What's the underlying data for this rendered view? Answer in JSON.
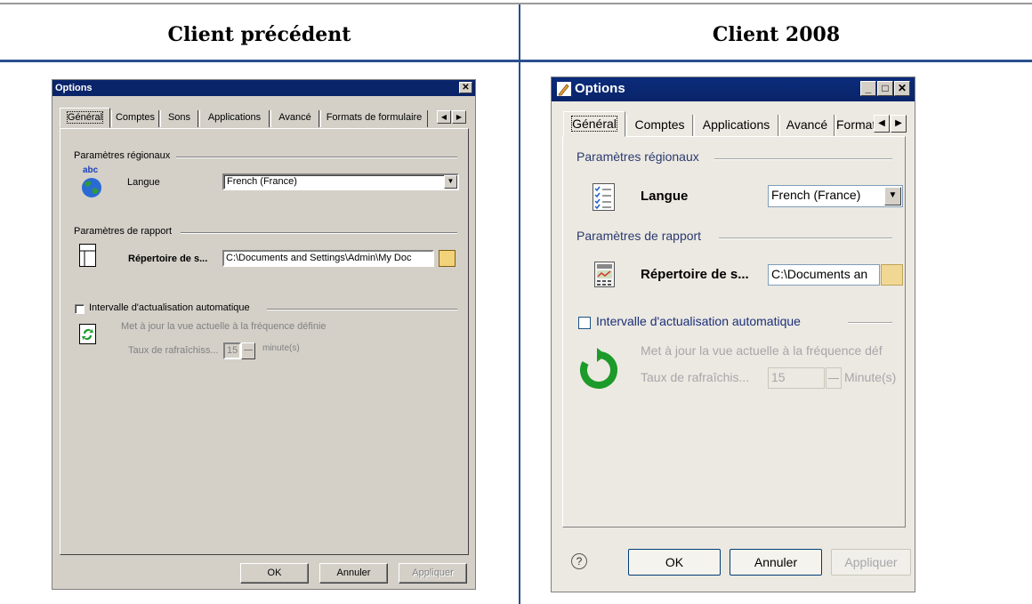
{
  "headers": {
    "left": "Client précédent",
    "right": "Client 2008"
  },
  "old_dialog": {
    "title": "Options",
    "close_glyph": "✕",
    "tabs": [
      "Général",
      "Comptes",
      "Sons",
      "Applications",
      "Avancé",
      "Formats de formulaire"
    ],
    "active_tab": "Général",
    "scroll_left": "◀",
    "scroll_right": "▶",
    "regional": {
      "group_label": "Paramètres régionaux",
      "icon_caption": "abc",
      "language_label": "Langue",
      "language_value": "French (France)",
      "drop_glyph": "▼"
    },
    "report": {
      "group_label": "Paramètres de rapport",
      "dir_label": "Répertoire de s...",
      "dir_value": "C:\\Documents and Settings\\Admin\\My Doc"
    },
    "refresh": {
      "checkbox_label": "Intervalle d'actualisation automatique",
      "checked": false,
      "description": "Met à jour la vue actuelle à la fréquence définie",
      "rate_label": "Taux de rafraîchiss...",
      "rate_value": "15",
      "unit": "minute(s)"
    },
    "buttons": {
      "ok": "OK",
      "cancel": "Annuler",
      "apply": "Appliquer"
    }
  },
  "new_dialog": {
    "title": "Options",
    "min_glyph": "_",
    "max_glyph": "□",
    "close_glyph": "✕",
    "tabs": [
      "Général",
      "Comptes",
      "Applications",
      "Avancé",
      "Format:"
    ],
    "active_tab": "Général",
    "scroll_left": "◀",
    "scroll_right": "▶",
    "regional": {
      "group_label": "Paramètres régionaux",
      "language_label": "Langue",
      "language_value": "French (France)",
      "drop_glyph": "▼"
    },
    "report": {
      "group_label": "Paramètres de rapport",
      "dir_label": "Répertoire de s...",
      "dir_value": "C:\\Documents an"
    },
    "refresh": {
      "checkbox_label": "Intervalle d'actualisation automatique",
      "checked": false,
      "description": "Met à jour la vue actuelle à la fréquence déf",
      "rate_label": "Taux de rafraîchis...",
      "rate_value": "15",
      "unit": "Minute(s)"
    },
    "help_glyph": "?",
    "buttons": {
      "ok": "OK",
      "cancel": "Annuler",
      "apply": "Appliquer"
    }
  },
  "colors": {
    "divider_blue": "#2a4f8f",
    "old_titlebar": "#0a246a",
    "old_face": "#d4d0c8",
    "new_face": "#ece9e2",
    "refresh_green": "#1c9a2a"
  }
}
